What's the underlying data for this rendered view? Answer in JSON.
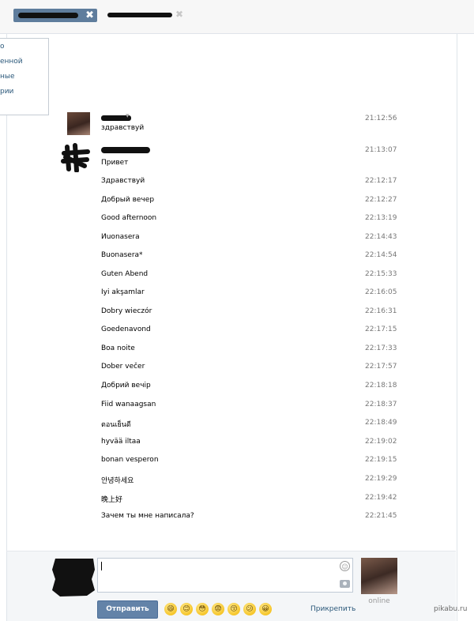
{
  "tabs": {
    "active": {
      "close": "✖"
    },
    "second": {
      "close": "✖"
    }
  },
  "dropdown": {
    "items": [
      "о",
      "енной",
      "ные",
      "рии"
    ]
  },
  "messages": [
    {
      "text": "здравствуй",
      "time": "21:12:56"
    },
    {
      "text": "Привет",
      "time": "21:13:07"
    },
    {
      "text": "Здравствуй",
      "time": "22:12:17"
    },
    {
      "text": "Добрый вечер",
      "time": "22:12:27"
    },
    {
      "text": "Good afternoon",
      "time": "22:13:19"
    },
    {
      "text": "Иuonasera",
      "time": "22:14:43"
    },
    {
      "text": "Buonasera*",
      "time": "22:14:54"
    },
    {
      "text": "Guten Abend",
      "time": "22:15:33"
    },
    {
      "text": "Iyi akşamlar",
      "time": "22:16:05"
    },
    {
      "text": "Dobry wieczór",
      "time": "22:16:31"
    },
    {
      "text": "Goedenavond",
      "time": "22:17:15"
    },
    {
      "text": "Boa noite",
      "time": "22:17:33"
    },
    {
      "text": "Dober večer",
      "time": "22:17:57"
    },
    {
      "text": "Добрий вечір",
      "time": "22:18:18"
    },
    {
      "text": "Fiid wanaagsan",
      "time": "22:18:37"
    },
    {
      "text": "ตอนเย็นดี",
      "time": "22:18:49"
    },
    {
      "text": "hyvää iltaa",
      "time": "22:19:02"
    },
    {
      "text": "bonan vesperon",
      "time": "22:19:15"
    },
    {
      "text": "안녕하세요",
      "time": "22:19:29"
    },
    {
      "text": "晚上好",
      "time": "22:19:42"
    },
    {
      "text": "Зачем ты мне написала?",
      "time": "22:21:45"
    }
  ],
  "composer": {
    "send_label": "Отправить",
    "attach_label": "Прикрепить",
    "peer_status": "online",
    "emoji_icon": "smile-icon",
    "camera_icon": "camera-icon",
    "smileys": [
      "😄",
      "😊",
      "😳",
      "😨",
      "😚",
      "😕",
      "😀"
    ]
  },
  "watermark": "pikabu.ru",
  "colors": {
    "send_button": "#6383a8",
    "active_tab": "#5f7d9d",
    "link": "#2b587a"
  }
}
